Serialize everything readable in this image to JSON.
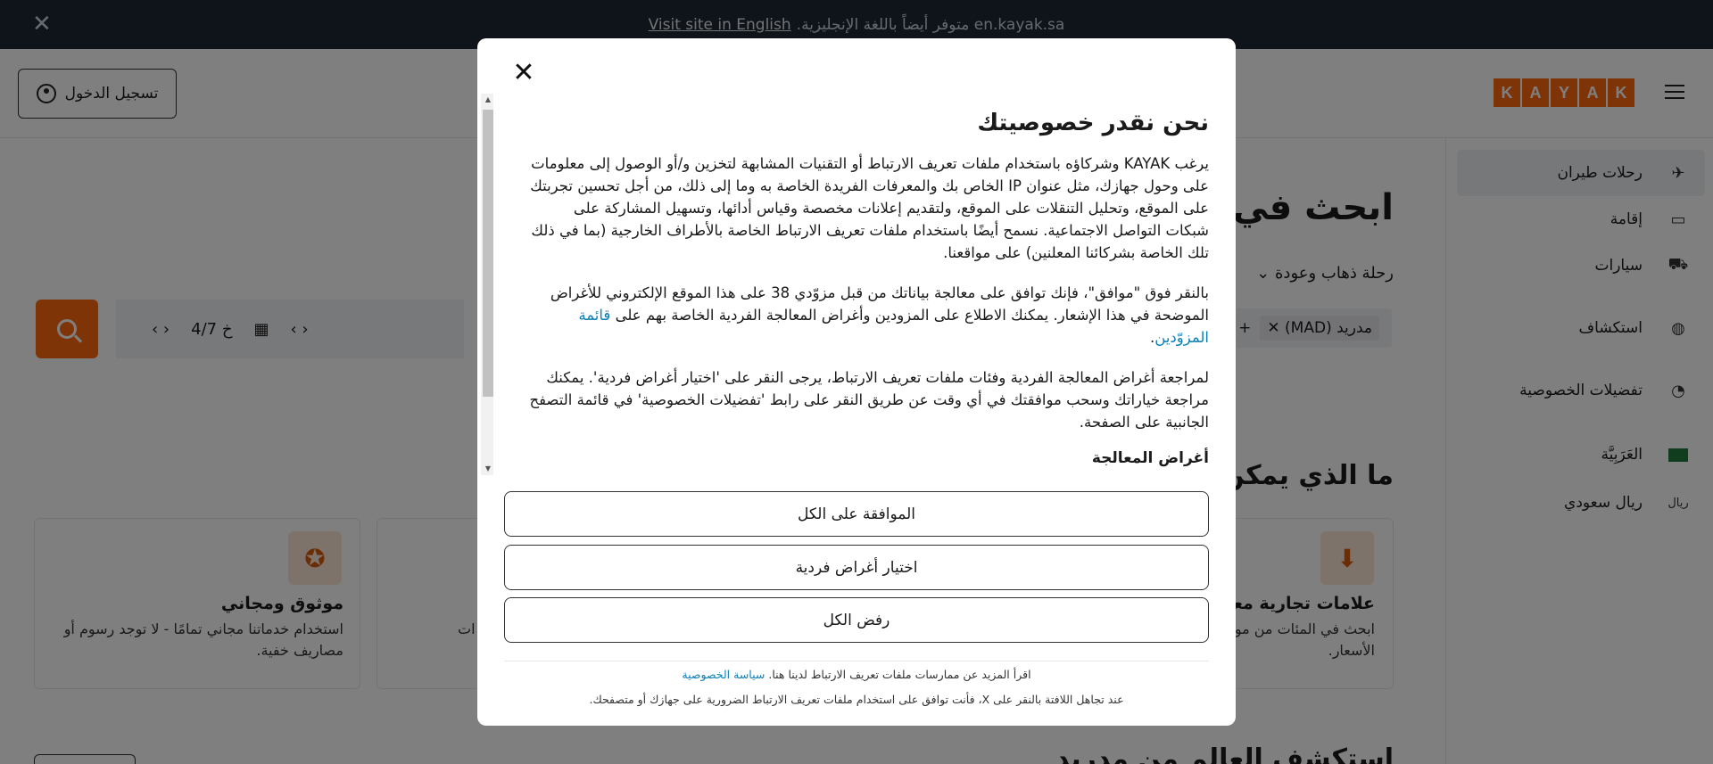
{
  "banner": {
    "text": "en.kayak.sa متوفر أيضاً باللغة الإنجليزية.",
    "link": "Visit site in English",
    "close_icon": "close-icon"
  },
  "header": {
    "login_label": "تسجيل الدخول",
    "logo_letters": [
      "K",
      "A",
      "Y",
      "A",
      "K"
    ]
  },
  "sidebar": {
    "items": [
      {
        "label": "رحلات طيران",
        "icon": "plane-icon"
      },
      {
        "label": "إقامة",
        "icon": "bed-icon"
      },
      {
        "label": "سيارات",
        "icon": "car-icon"
      },
      {
        "label": "استكشاف",
        "icon": "globe-icon"
      },
      {
        "label": "تفضيلات الخصوصية",
        "icon": "cookie-icon"
      },
      {
        "label": "العَرَبِيَّة",
        "icon": "flag-icon"
      },
      {
        "label": "ريال سعودي",
        "icon": "currency-icon",
        "icon_text": "ريال"
      }
    ]
  },
  "main": {
    "title": "ابحث في م",
    "trip_type": "رحلة ذهاب وعودة",
    "origin_chip": "مدريد (MAD)",
    "date_text": "خ 4/7",
    "section_title": "ما الذي يمكن أ",
    "cards": [
      {
        "title": "موثوق ومجاني",
        "text": "استخدام خدماتنا مجاني تمامًا - لا توجد رسوم أو مصاريف خفية."
      },
      {
        "title": "علامات تجارية معرو",
        "text": "ابحث في المئات من مو الأسعار."
      }
    ],
    "card_mid_fragment": "ات",
    "explore_title": "استكشف العالم من مدريد"
  },
  "modal": {
    "title": "نحن نقدر خصوصيتك",
    "para1": "يرغب KAYAK وشركاؤه باستخدام ملفات تعريف الارتباط أو التقنيات المشابهة لتخزين و/أو الوصول إلى معلومات على وحول جهازك، مثل عنوان IP الخاص بك والمعرفات الفريدة الخاصة به وما إلى ذلك، من أجل تحسين تجربتك على الموقع، وتحليل التنقلات على الموقع، ولتقديم إعلانات مخصصة وقياس أدائها، وتسهيل المشاركة على شبكات التواصل الاجتماعية. نسمح أيضًا باستخدام ملفات تعريف الارتباط الخاصة بالأطراف الخارجية (بما في ذلك تلك الخاصة بشركائنا المعلنين) على مواقعنا.",
    "para2": "بالنقر فوق \"موافق\"، فإنك توافق على معالجة بياناتك من قبل مزوّدي 38 على هذا الموقع الإلكتروني للأغراض الموضحة في هذا الإشعار. يمكنك الاطلاع على المزودين وأغراض المعالجة الفردية الخاصة بهم على",
    "para2_link": "قائمة المزوّدين",
    "para3": "لمراجعة أغراض المعالجة الفردية وفئات ملفات تعريف الارتباط، يرجى النقر على 'اختيار أغراض فردية'. يمكنك مراجعة خياراتك وسحب موافقتك في أي وقت عن طريق النقر على رابط 'تفضيلات الخصوصية' في قائمة التصفح الجانبية على الصفحة.",
    "subheading": "أغراض المعالجة",
    "btn_accept": "الموافقة على الكل",
    "btn_choose": "اختيار أغراض فردية",
    "btn_reject": "رفض الكل",
    "foot1_text": "اقرأ المزيد عن ممارسات ملفات تعريف الارتباط لدينا هنا.",
    "foot1_link": "سياسة الخصوصية",
    "foot2_text": "عند تجاهل اللافتة بالنقر على X، فأنت توافق على استخدام ملفات تعريف الارتباط الضرورية على جهازك أو متصفحك."
  }
}
